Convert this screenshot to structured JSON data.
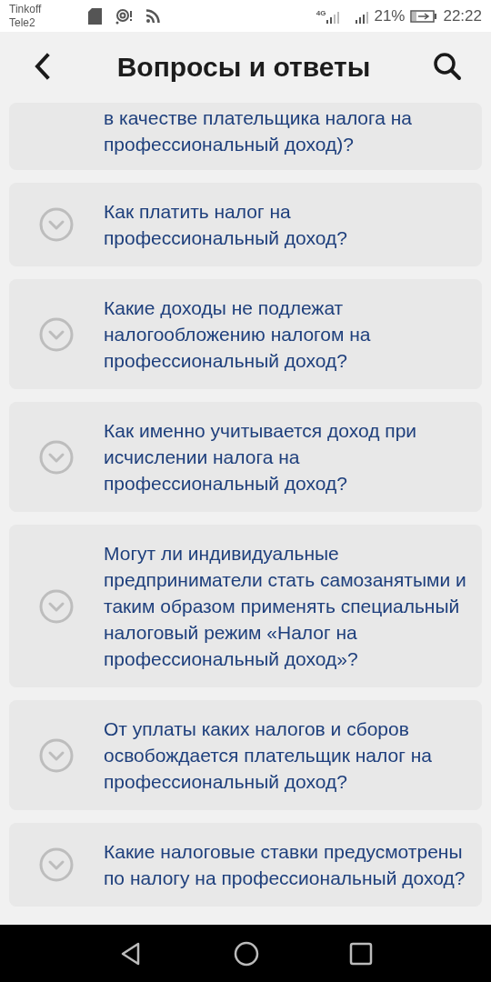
{
  "status_bar": {
    "carriers": [
      "Tinkoff",
      "Tele2"
    ],
    "network": "4G",
    "battery": "21%",
    "time": "22:22"
  },
  "header": {
    "title": "Вопросы и ответы"
  },
  "questions": [
    {
      "text": "в качестве плательщика налога на профессиональный доход)?",
      "kind": "partial"
    },
    {
      "text": "Как платить налог на профессиональный доход?",
      "expanded": false,
      "kind": "full"
    },
    {
      "text": "Какие доходы не подлежат налогообложению налогом на профессиональный доход?",
      "expanded": false,
      "kind": "full"
    },
    {
      "text": "Как именно учитывается доход при исчислении налога на профессиональный доход?",
      "expanded": false,
      "kind": "full"
    },
    {
      "text": "Могут ли индивидуальные предприниматели стать самозанятыми и таким образом применять специальный налоговый режим «Налог на профессиональный доход»?",
      "expanded": false,
      "kind": "full"
    },
    {
      "text": "От уплаты каких налогов и сборов освобождается плательщик налог на профессиональный доход?",
      "expanded": false,
      "kind": "full"
    },
    {
      "text": "Какие налоговые ставки предусмотрены по налогу на профессиональный доход?",
      "expanded": false,
      "kind": "full"
    }
  ]
}
